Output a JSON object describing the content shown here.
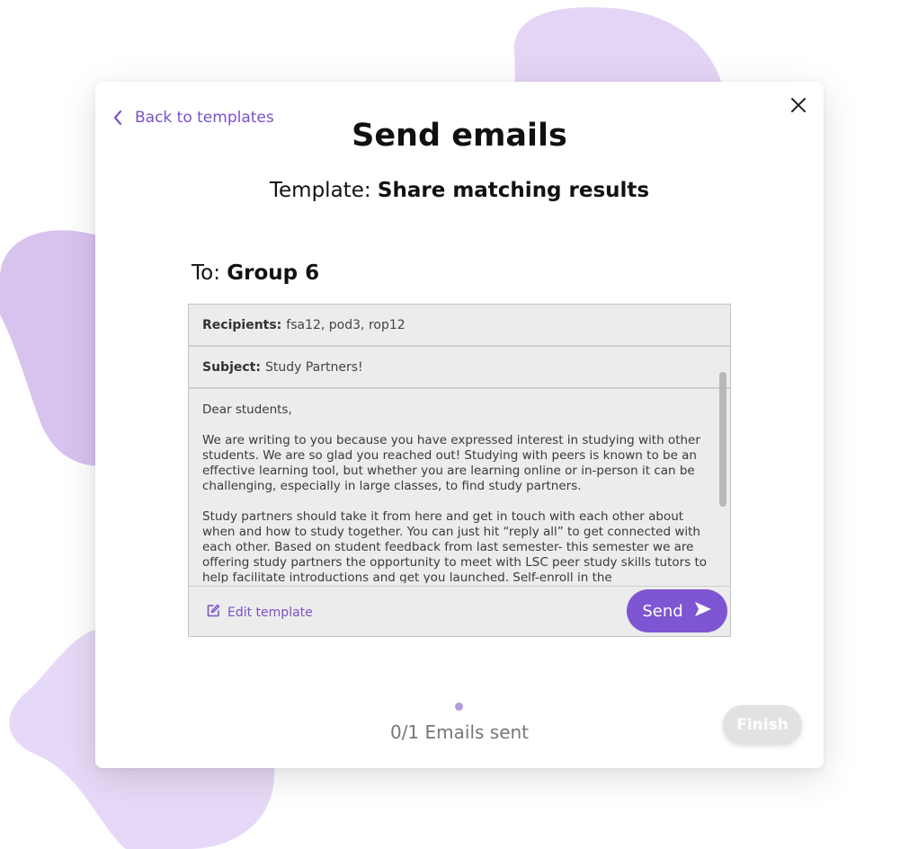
{
  "nav": {
    "back_label": "Back to templates"
  },
  "dialog": {
    "title": "Send emails",
    "template_prefix": "Template:",
    "template_name": "Share matching results",
    "to_prefix": "To:",
    "to_group": "Group 6"
  },
  "email": {
    "recipients_label": "Recipients:",
    "recipients_value": "fsa12, pod3, rop12",
    "subject_label": "Subject:",
    "subject_value": "Study Partners!",
    "body": [
      "Dear students,",
      "We are writing to you because you have expressed interest in studying with other students. We are so glad you reached out! Studying with peers is known to be an effective learning tool, but whether you are learning online or in-person it can be challenging, especially in large classes, to find study partners.",
      "Study partners should take it from here and get in touch with each other about when and how to study together. You can just hit “reply all” to get connected with each other. Based on student feedback from last semester- this semester we are offering study partners the opportunity to meet with LSC peer study skills tutors to help facilitate introductions and get you launched. Self-enroll in the"
    ],
    "edit_label": "Edit template",
    "send_label": "Send"
  },
  "progress": {
    "status_text": "0/1 Emails sent",
    "sent": 0,
    "total": 1
  },
  "finish_label": "Finish",
  "colors": {
    "accent": "#7e55d3",
    "link": "#7a52c7",
    "blob": "#e3d3f5",
    "blob_dark": "#d6c0ee",
    "disabled": "#e2e2e2"
  },
  "icons": [
    "chevron-left-icon",
    "close-icon",
    "edit-icon",
    "send-icon"
  ]
}
